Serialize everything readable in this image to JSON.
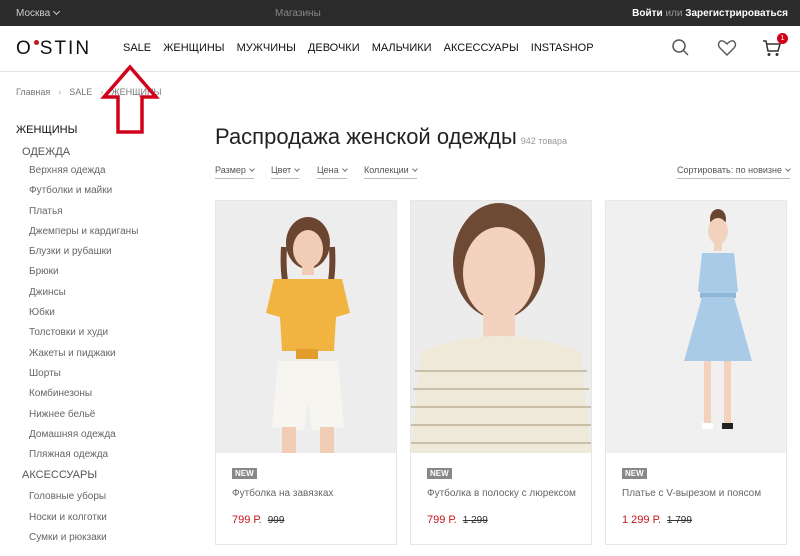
{
  "topbar": {
    "city": "Москва",
    "stores": "Магазины",
    "login": "Войти",
    "or": "или",
    "register": "Зарегистрироваться"
  },
  "header": {
    "logo": "O'STIN",
    "nav": [
      "SALE",
      "ЖЕНЩИНЫ",
      "МУЖЧИНЫ",
      "ДЕВОЧКИ",
      "МАЛЬЧИКИ",
      "АКСЕССУАРЫ",
      "INSTASHOP"
    ],
    "cart_count": "1"
  },
  "breadcrumb": [
    "Главная",
    "SALE",
    "ЖЕНЩИНЫ"
  ],
  "sidebar": {
    "category": "ЖЕНЩИНЫ",
    "subcategory": "ОДЕЖДА",
    "items": [
      "Верхняя одежда",
      "Футболки и майки",
      "Платья",
      "Джемперы и кардиганы",
      "Блузки и рубашки",
      "Брюки",
      "Джинсы",
      "Юбки",
      "Толстовки и худи",
      "Жакеты и пиджаки",
      "Шорты",
      "Комбинезоны",
      "Нижнее бельё",
      "Домашняя одежда",
      "Пляжная одежда"
    ],
    "subcategory2": "АКСЕССУАРЫ",
    "items2": [
      "Головные уборы",
      "Носки и колготки",
      "Сумки и рюкзаки"
    ]
  },
  "main": {
    "title": "Распродажа женской одежды",
    "count": "942 товара",
    "filters": [
      "Размер",
      "Цвет",
      "Цена",
      "Коллекции"
    ],
    "sort": "Сортировать: по новизне"
  },
  "products": [
    {
      "badge": "NEW",
      "name": "Футболка на завязках",
      "price": "799 Р.",
      "old_price": "999",
      "color": "#f2b441"
    },
    {
      "badge": "NEW",
      "name": "Футболка в полоску с люрексом",
      "price": "799 Р.",
      "old_price": "1 299",
      "color": "#efe9da"
    },
    {
      "badge": "NEW",
      "name": "Платье с V-вырезом и поясом",
      "price": "1 299 Р.",
      "old_price": "1 799",
      "color": "#a9cbe8"
    }
  ],
  "colors": {
    "accent": "#c4161c",
    "topbar": "#2b2b2b"
  }
}
